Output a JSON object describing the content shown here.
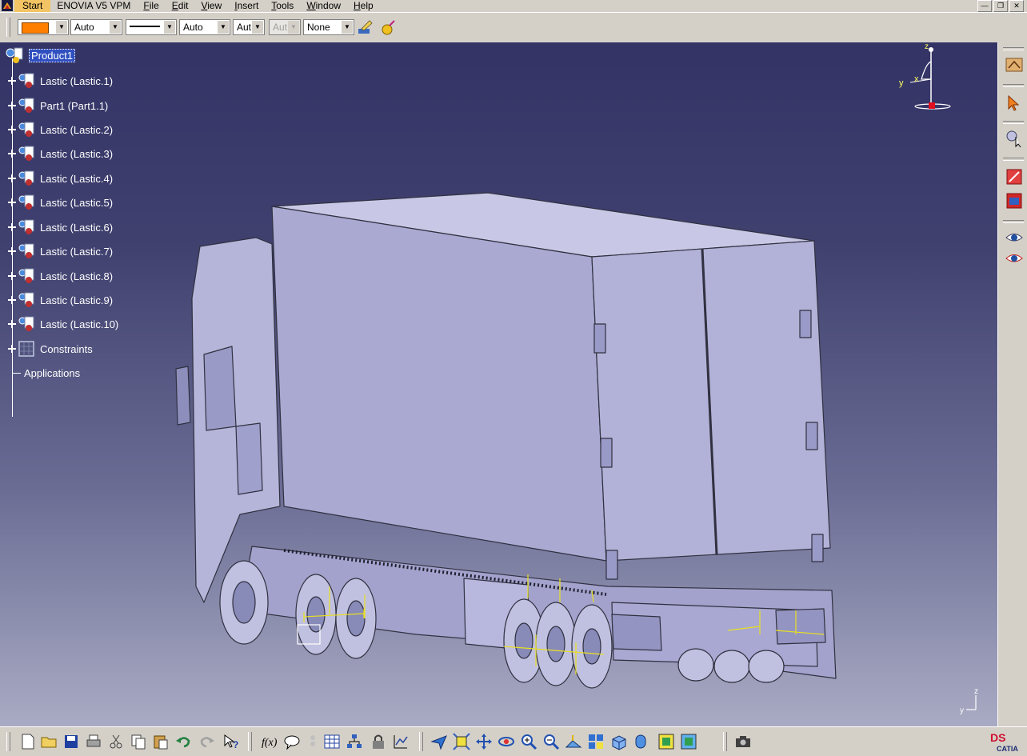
{
  "menubar": {
    "start": "Start",
    "app_name": "ENOVIA V5 VPM",
    "items": [
      {
        "label": "File",
        "underline": "F",
        "rest": "ile"
      },
      {
        "label": "Edit",
        "underline": "E",
        "rest": "dit"
      },
      {
        "label": "View",
        "underline": "V",
        "rest": "iew"
      },
      {
        "label": "Insert",
        "underline": "I",
        "rest": "nsert"
      },
      {
        "label": "Tools",
        "underline": "T",
        "rest": "ools"
      },
      {
        "label": "Window",
        "underline": "W",
        "rest": "indow"
      },
      {
        "label": "Help",
        "underline": "H",
        "rest": "elp"
      }
    ]
  },
  "properties_toolbar": {
    "fill_color": "#ff8000",
    "transparency": "Auto",
    "line_thickness": "Auto",
    "line_type": "Aut",
    "point_type": "Aut",
    "layer": "None"
  },
  "tree": {
    "root": "Product1",
    "children": [
      "Lastic (Lastic.1)",
      "Part1 (Part1.1)",
      "Lastic (Lastic.2)",
      "Lastic (Lastic.3)",
      "Lastic (Lastic.4)",
      "Lastic (Lastic.5)",
      "Lastic (Lastic.6)",
      "Lastic (Lastic.7)",
      "Lastic (Lastic.8)",
      "Lastic (Lastic.9)",
      "Lastic (Lastic.10)",
      "Constraints"
    ],
    "applications": "Applications"
  },
  "compass": {
    "x": "x",
    "y": "y",
    "z": "z"
  },
  "corner_axis": {
    "y": "y",
    "z": "z"
  },
  "brand": {
    "ds": "DS",
    "catia": "CATIA"
  },
  "colors": {
    "viewport_top": "#333366",
    "viewport_bottom": "#a9abc4",
    "selection": "#3050c0",
    "accent_orange": "#ff8000"
  },
  "icons": {
    "right_toolbar": [
      "sketcher-icon",
      "select-arrow-icon",
      "snap-icon",
      "catalog-red-icon",
      "photo-studio-icon",
      "hide-show-icon",
      "swap-visible-icon"
    ],
    "bottom_toolbar": [
      "new-icon",
      "open-icon",
      "save-icon",
      "print-icon",
      "cut-icon",
      "copy-icon",
      "paste-icon",
      "undo-icon",
      "redo-icon",
      "whats-this-icon",
      "formula-icon",
      "comment-icon",
      "knowledge-icon",
      "table-icon",
      "tree-icon",
      "lock-icon",
      "graph-icon",
      "fly-icon",
      "fit-all-icon",
      "pan-icon",
      "rotate-icon",
      "zoom-in-icon",
      "zoom-out-icon",
      "normal-view-icon",
      "multi-view-icon",
      "iso-view-icon",
      "shading-icon",
      "hide-icon",
      "swap-icon",
      "capture-icon"
    ]
  }
}
